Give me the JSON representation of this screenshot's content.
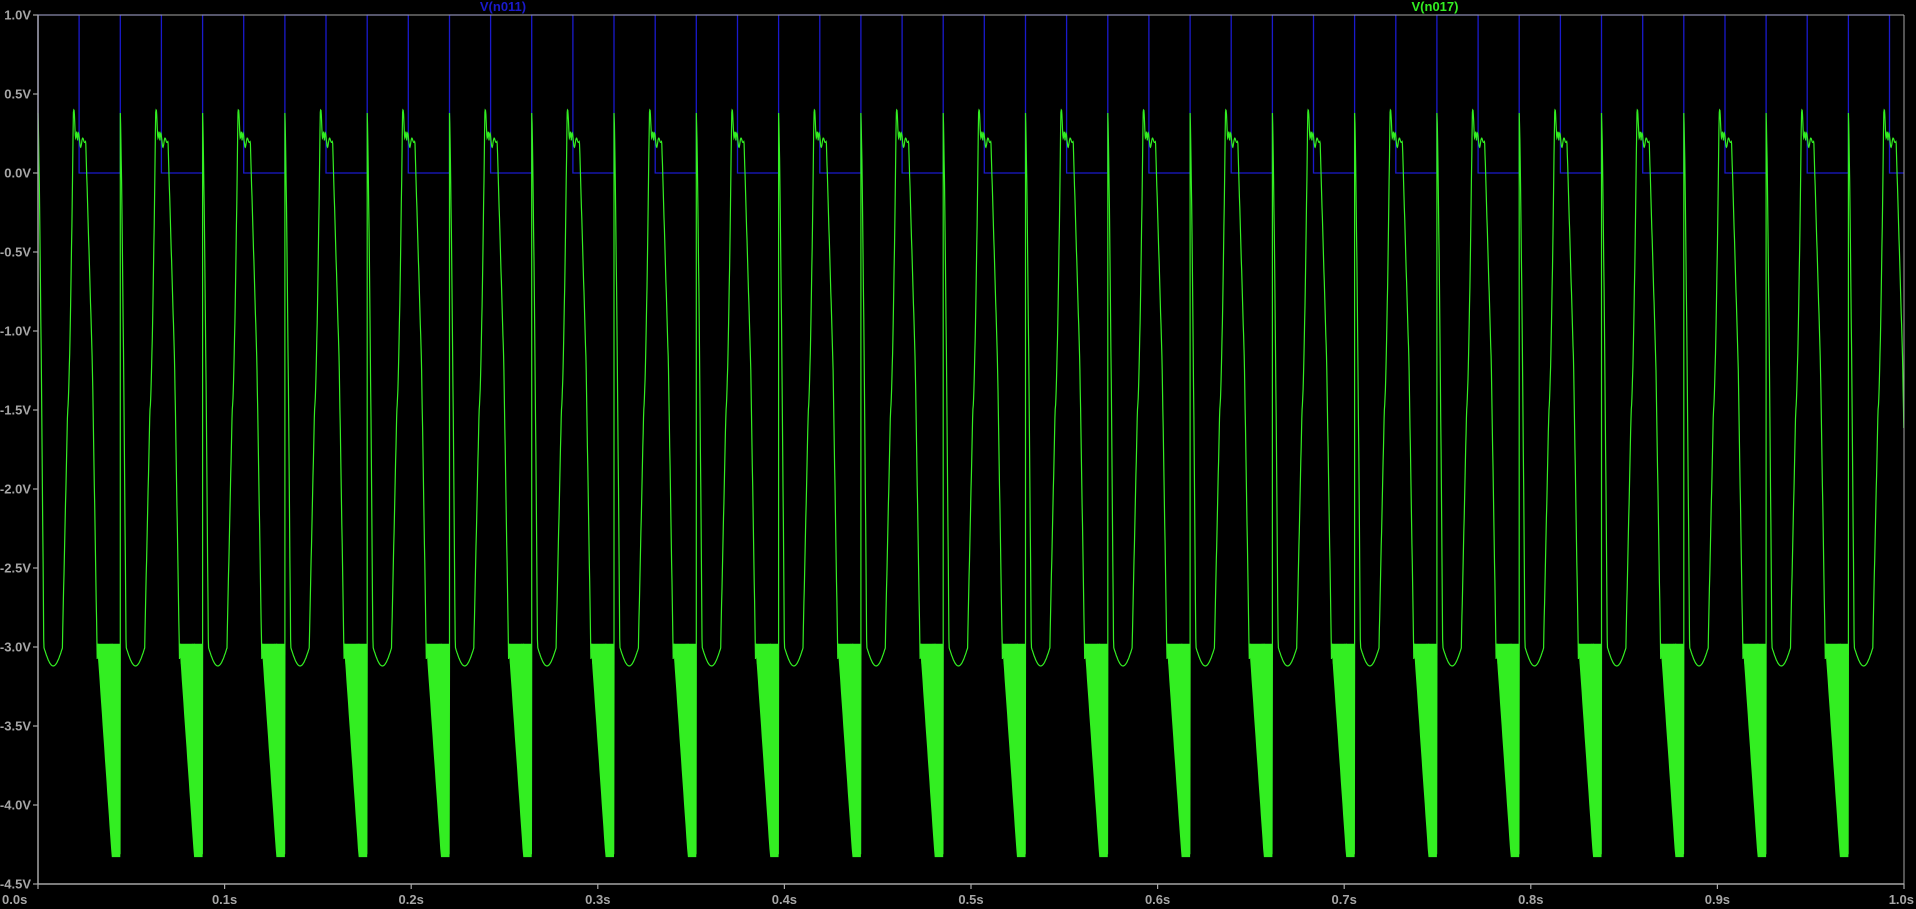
{
  "window": {
    "background": "#000000",
    "axis_color": "#a6a6a6"
  },
  "chart_data": {
    "type": "line",
    "title": "",
    "xlabel": "",
    "ylabel": "",
    "xlim": [
      0.0,
      1.0
    ],
    "ylim": [
      -4.5,
      1.0
    ],
    "grid": false,
    "legend_placement": "top",
    "x_ticks": [
      {
        "value": 0.0,
        "label": "0.0s"
      },
      {
        "value": 0.1,
        "label": "0.1s"
      },
      {
        "value": 0.2,
        "label": "0.2s"
      },
      {
        "value": 0.3,
        "label": "0.3s"
      },
      {
        "value": 0.4,
        "label": "0.4s"
      },
      {
        "value": 0.5,
        "label": "0.5s"
      },
      {
        "value": 0.6,
        "label": "0.6s"
      },
      {
        "value": 0.7,
        "label": "0.7s"
      },
      {
        "value": 0.8,
        "label": "0.8s"
      },
      {
        "value": 0.9,
        "label": "0.9s"
      },
      {
        "value": 1.0,
        "label": "1.0s"
      }
    ],
    "y_ticks": [
      {
        "value": 1.0,
        "label": "1.0V"
      },
      {
        "value": 0.5,
        "label": "0.5V"
      },
      {
        "value": 0.0,
        "label": "0.0V"
      },
      {
        "value": -0.5,
        "label": "-0.5V"
      },
      {
        "value": -1.0,
        "label": "-1.0V"
      },
      {
        "value": -1.5,
        "label": "-1.5V"
      },
      {
        "value": -2.0,
        "label": "-2.0V"
      },
      {
        "value": -2.5,
        "label": "-2.5V"
      },
      {
        "value": -3.0,
        "label": "-3.0V"
      },
      {
        "value": -3.5,
        "label": "-3.5V"
      },
      {
        "value": -4.0,
        "label": "-4.0V"
      },
      {
        "value": -4.5,
        "label": "-4.5V"
      }
    ],
    "series": [
      {
        "name": "V(n011)",
        "color": "#1a1acc",
        "kind": "square",
        "period": 0.0441,
        "high": 1.0,
        "low": 0.0,
        "duty": 0.5,
        "first_rise": 0.0
      },
      {
        "name": "V(n017)",
        "color": "#33ee22",
        "kind": "pulsed_ringing",
        "period": 0.0441,
        "peak": 0.38,
        "plateau": 0.2,
        "shelf": -3.0,
        "floor": -4.33,
        "start": 0.0
      }
    ]
  }
}
